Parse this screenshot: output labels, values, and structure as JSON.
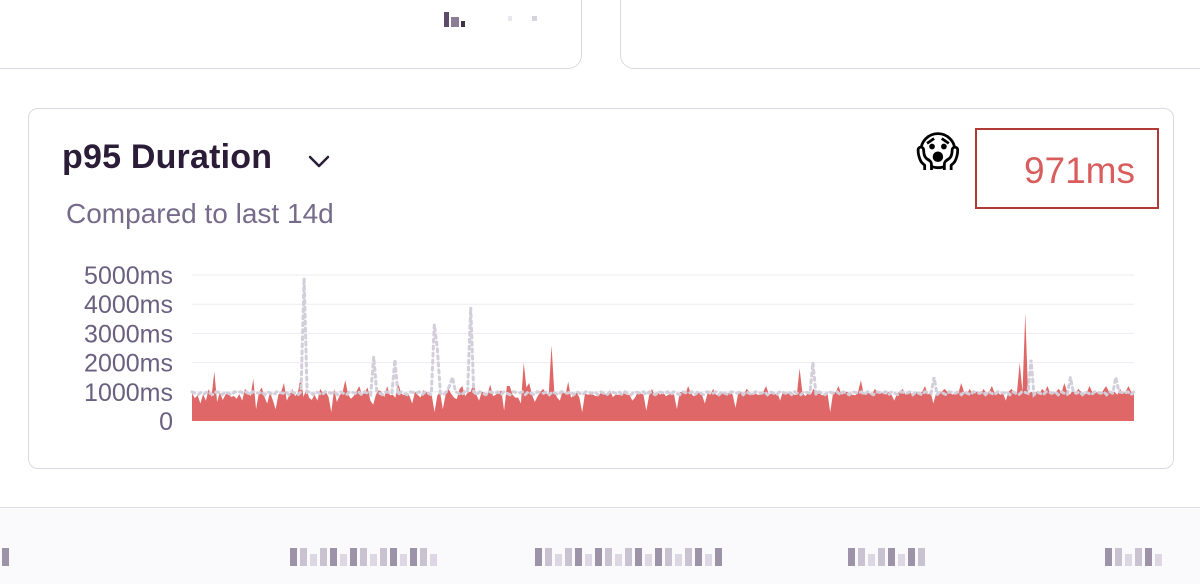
{
  "widget": {
    "title": "p95 Duration",
    "subtitle": "Compared to last 14d",
    "value": "971ms",
    "emoji": "😱",
    "title_menu_icon": "chevron-down-icon"
  },
  "colors": {
    "current_series": "#e06767",
    "previous_series": "#d2cfdb",
    "value_text": "#d95d5d",
    "highlight_box": "#b23a36",
    "title_text": "#2b1d38",
    "subtitle_text": "#766b8a"
  },
  "chart_data": {
    "type": "area",
    "yticks": [
      "5000ms",
      "4000ms",
      "3000ms",
      "2000ms",
      "1000ms",
      "0"
    ],
    "ylim": [
      0,
      5000
    ],
    "grid": true,
    "series": [
      {
        "style": "filled-area",
        "values": [
          950,
          780,
          880,
          600,
          920,
          700,
          1100,
          820,
          1700,
          650,
          980,
          720,
          900,
          1000,
          820,
          860,
          760,
          920,
          700,
          1100,
          1000,
          850,
          1450,
          400,
          980,
          1150,
          820,
          600,
          980,
          720,
          400,
          900,
          1000,
          1300,
          700,
          900,
          1100,
          850,
          980,
          1500,
          820,
          1100,
          800,
          720,
          900,
          700,
          1100,
          950,
          1000,
          820,
          300,
          1100,
          650,
          880,
          980,
          1400,
          900,
          760,
          850,
          1000,
          1200,
          900,
          980,
          1150,
          700,
          560,
          900,
          1050,
          1000,
          820,
          1200,
          880,
          900,
          800,
          1300,
          950,
          880,
          980,
          860,
          600,
          1000,
          900,
          800,
          1050,
          1000,
          980,
          900,
          300,
          870,
          1000,
          400,
          900,
          1100,
          930,
          800,
          750,
          1100,
          1200,
          850,
          980,
          1000,
          1300,
          900,
          700,
          1000,
          980,
          900,
          1250,
          850,
          900,
          980,
          1050,
          350,
          1200,
          1200,
          900,
          800,
          800,
          600,
          2000,
          1150,
          1300,
          900,
          650,
          850,
          1000,
          1100,
          950,
          900,
          2600,
          1000,
          800,
          700,
          1050,
          900,
          1350,
          800,
          880,
          980,
          800,
          300,
          950,
          900,
          920,
          900,
          850,
          880,
          1000,
          900,
          950,
          1050,
          820,
          900,
          900,
          900,
          950,
          900,
          900,
          700,
          800,
          1000,
          950,
          900,
          350,
          870,
          1100,
          900,
          980,
          900,
          1000,
          850,
          900,
          950,
          900,
          400,
          980,
          1000,
          900,
          1200,
          950,
          850,
          900,
          980,
          900,
          600,
          950,
          900,
          1100,
          900,
          880,
          980,
          900,
          920,
          1000,
          900,
          450,
          950,
          1000,
          900,
          1100,
          1000,
          900,
          950,
          900,
          900,
          1000,
          1200,
          900,
          950,
          900,
          980,
          700,
          1000,
          900,
          950,
          1000,
          900,
          900,
          1800,
          1000,
          850,
          950,
          900,
          1100,
          1000,
          950,
          880,
          900,
          980,
          300,
          950,
          1000,
          1200,
          900,
          980,
          1000,
          950,
          900,
          880,
          1000,
          1400,
          900,
          1000,
          950,
          900,
          1100,
          1000,
          950,
          980,
          900,
          1000,
          900,
          700,
          950,
          1000,
          1100,
          900,
          1000,
          950,
          900,
          1000,
          950,
          1000,
          1200,
          900,
          1000,
          600,
          950,
          900,
          1000,
          1100,
          1000,
          950,
          900,
          1000,
          950,
          1300,
          1000,
          900,
          1100,
          950,
          1000,
          1000,
          900,
          1100,
          950,
          1000,
          1200,
          950,
          1000,
          900,
          950,
          700,
          1000,
          1100,
          1000,
          950,
          2000,
          1000,
          3700,
          900,
          1000,
          950,
          1000,
          900,
          1100,
          1000,
          1200,
          900,
          950,
          1000,
          1100,
          950,
          1300,
          1000,
          900,
          1050,
          950,
          1100,
          1000,
          900,
          950,
          1200,
          1000,
          950,
          1000,
          900,
          1050,
          1200,
          1000,
          950,
          1000,
          900,
          1100,
          950,
          1000,
          1200,
          1000,
          900
        ]
      },
      {
        "style": "dotted-line",
        "values": [
          1000,
          950,
          900,
          980,
          920,
          1000,
          950,
          900,
          1000,
          980,
          900,
          1000,
          950,
          900,
          1000,
          980,
          1000,
          950,
          1000,
          900,
          1000,
          980,
          950,
          1000,
          900,
          1000,
          950,
          900,
          1000,
          980,
          950,
          1000,
          900,
          1000,
          950,
          900,
          1000,
          4900,
          980,
          1000,
          900,
          1000,
          950,
          900,
          1000,
          980,
          950,
          1000,
          900,
          1000,
          950,
          900,
          1000,
          980,
          950,
          1000,
          900,
          1000,
          950,
          900,
          2200,
          1000,
          950,
          900,
          1000,
          980,
          950,
          2100,
          900,
          1000,
          950,
          900,
          1000,
          980,
          950,
          1000,
          900,
          1000,
          950,
          900,
          3300,
          2500,
          950,
          900,
          1000,
          1200,
          1500,
          1000,
          950,
          900,
          1000,
          980,
          3900,
          1000,
          900,
          1000,
          950,
          900,
          1000,
          980,
          950,
          1000,
          900,
          1000,
          950,
          900,
          1000,
          980,
          950,
          1000,
          900,
          1000,
          950,
          900,
          1000,
          980,
          950,
          1000,
          900,
          1000,
          950,
          900,
          1000,
          980,
          950,
          1000,
          900,
          1000,
          950,
          900,
          1000,
          980,
          950,
          1000,
          900,
          1000,
          950,
          900,
          1000,
          980,
          950,
          1000,
          900,
          1000,
          950,
          900,
          1000,
          980,
          950,
          1000,
          900,
          1000,
          950,
          900,
          1000,
          980,
          950,
          1000,
          900,
          1000,
          950,
          900,
          1000,
          980,
          950,
          1000,
          900,
          1000,
          950,
          900,
          1000,
          980,
          950,
          1000,
          900,
          1000,
          950,
          900,
          1000,
          980,
          950,
          1000,
          900,
          1000,
          950,
          900,
          1000,
          980,
          950,
          1000,
          900,
          1000,
          950,
          900,
          1000,
          980,
          950,
          1000,
          900,
          1000,
          950,
          900,
          1000,
          980,
          950,
          2000,
          900,
          1000,
          950,
          900,
          1000,
          980,
          950,
          1000,
          900,
          1000,
          950,
          900,
          1000,
          980,
          950,
          1000,
          900,
          1000,
          950,
          900,
          1000,
          980,
          950,
          1000,
          900,
          1000,
          950,
          900,
          1000,
          980,
          950,
          1000,
          900,
          1000,
          950,
          900,
          1000,
          980,
          950,
          1500,
          900,
          1000,
          950,
          900,
          1000,
          980,
          950,
          1000,
          900,
          1000,
          950,
          900,
          1000,
          980,
          950,
          1000,
          900,
          1000,
          950,
          900,
          1000,
          980,
          950,
          1000,
          900,
          1000,
          950,
          900,
          1000,
          980,
          950,
          2100,
          900,
          1000,
          950,
          900,
          1000,
          980,
          950,
          1000,
          900,
          1000,
          950,
          900,
          1500,
          980,
          950,
          1000,
          900,
          1000,
          950,
          900,
          1000,
          980,
          950,
          1000,
          900,
          1000,
          950,
          1500,
          1000,
          980,
          950,
          1000,
          900,
          1000
        ]
      }
    ]
  }
}
